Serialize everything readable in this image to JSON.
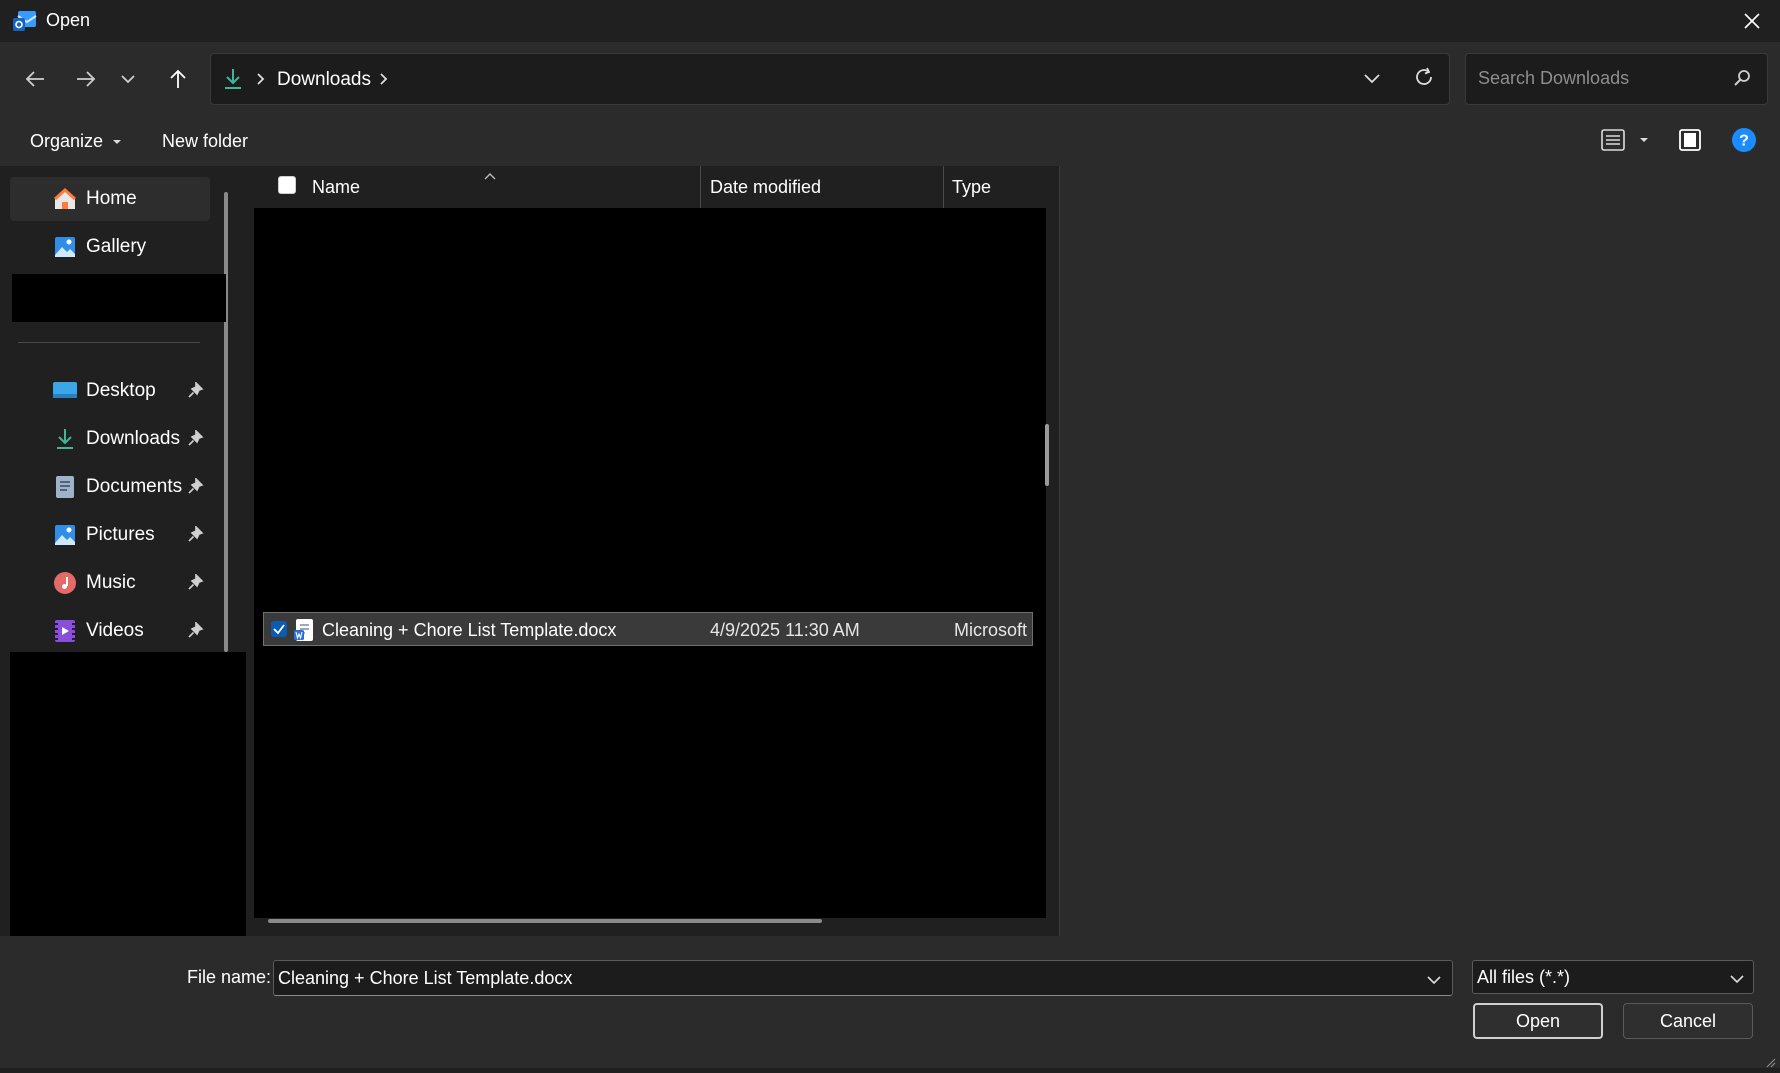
{
  "window": {
    "title": "Open"
  },
  "address": {
    "crumb": "Downloads"
  },
  "search": {
    "placeholder": "Search Downloads"
  },
  "commands": {
    "organize": "Organize",
    "new_folder": "New folder"
  },
  "sidebar": {
    "top": [
      {
        "label": "Home"
      },
      {
        "label": "Gallery"
      }
    ],
    "pinned": [
      {
        "label": "Desktop"
      },
      {
        "label": "Downloads"
      },
      {
        "label": "Documents"
      },
      {
        "label": "Pictures"
      },
      {
        "label": "Music"
      },
      {
        "label": "Videos"
      }
    ]
  },
  "columns": {
    "name": "Name",
    "date": "Date modified",
    "type": "Type"
  },
  "selected_file": {
    "name": "Cleaning + Chore List Template.docx",
    "date": "4/9/2025 11:30 AM",
    "type": "Microsoft"
  },
  "bottom": {
    "file_name_label": "File name:",
    "file_name_value": "Cleaning + Chore List Template.docx",
    "filter": "All files (*.*)",
    "open": "Open",
    "cancel": "Cancel"
  },
  "colors": {
    "accent": "#4cc2ff",
    "help": "#1a8cff",
    "downloads_icon": "#3fb59a"
  }
}
